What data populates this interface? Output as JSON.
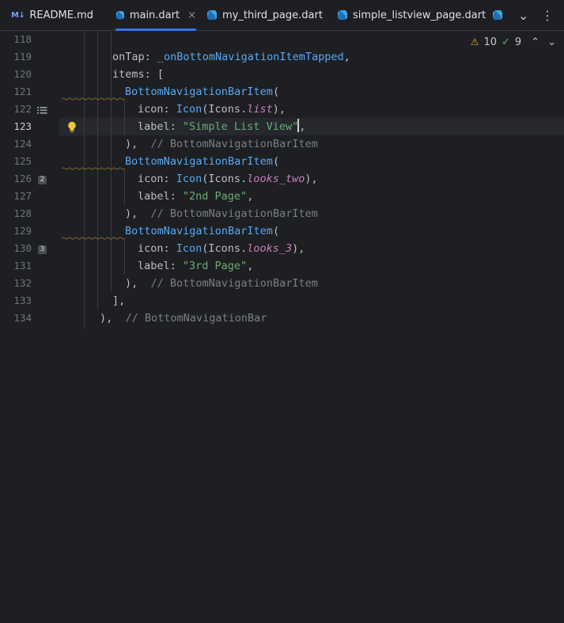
{
  "tabs": [
    {
      "label": "README.md",
      "icon": "markdown-icon",
      "active": false
    },
    {
      "label": "main.dart",
      "icon": "dart-icon",
      "active": true,
      "close": "×"
    },
    {
      "label": "my_third_page.dart",
      "icon": "dart-icon",
      "active": false
    },
    {
      "label": "simple_listview_page.dart",
      "icon": "dart-icon",
      "active": false
    }
  ],
  "markdown_icon_text": "M↓",
  "toolbar": {
    "dropdown": "⌄",
    "menu": "⋮"
  },
  "inspections": {
    "warnings": "10",
    "checks": "9",
    "warning_icon": "⚠",
    "check_icon": "✓̸",
    "up": "⌃",
    "down": "⌄"
  },
  "editor": {
    "line_numbers": [
      "118",
      "119",
      "120",
      "121",
      "122",
      "123",
      "124",
      "125",
      "126",
      "127",
      "128",
      "129",
      "130",
      "131",
      "132",
      "133",
      "134"
    ],
    "current_line": "123",
    "gutter_badges": {
      "126": "2",
      "130": "3"
    },
    "tokens": {
      "ontap": "onTap: ",
      "ontap_fn": "_onBottomNavigationItemTapped",
      "ontap_end": ",",
      "items": "items: [",
      "item_cls": "BottomNavigationBarItem",
      "paren_open": "(",
      "icon_key": "icon: ",
      "icon_cls": "Icon",
      "icons_prefix": "(Icons.",
      "icon1": "list",
      "icon2": "looks_two",
      "icon3": "looks_3",
      "icon_end": "),",
      "label_key": "label: ",
      "label1": "\"Simple List View\"",
      "label2": "\"2nd Page\"",
      "label3": "\"3rd Page\"",
      "comma": ",",
      "close_item": "),",
      "comment_item": "// BottomNavigationBarItem",
      "close_list": "],",
      "close_bar": "),",
      "comment_bar": "// BottomNavigationBar"
    }
  },
  "colors": {
    "accent": "#3574f0",
    "background": "#1e1f22"
  }
}
